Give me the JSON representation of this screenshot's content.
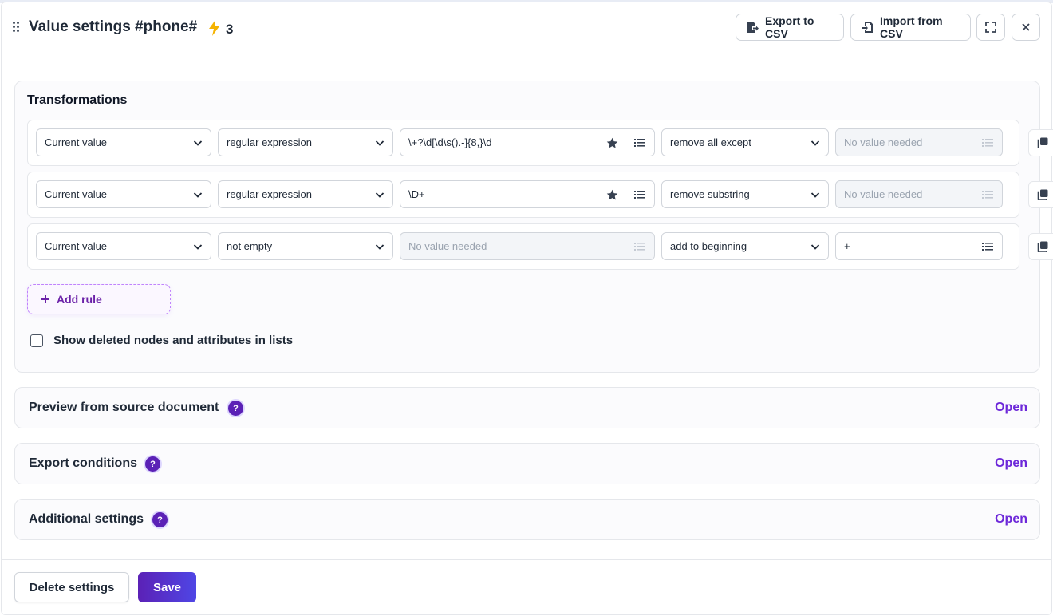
{
  "header": {
    "title": "Value settings #phone#",
    "count": "3",
    "export_label": "Export to CSV",
    "import_label": "Import from CSV"
  },
  "transformations": {
    "title": "Transformations",
    "rules": [
      {
        "source": "Current value",
        "condition": "regular expression",
        "pattern": "\\+?\\d[\\d\\s().-]{8,}\\d",
        "pattern_placeholder": "",
        "action": "remove all except",
        "action_value": "",
        "action_value_placeholder": "No value needed"
      },
      {
        "source": "Current value",
        "condition": "regular expression",
        "pattern": "\\D+",
        "pattern_placeholder": "",
        "action": "remove substring",
        "action_value": "",
        "action_value_placeholder": "No value needed"
      },
      {
        "source": "Current value",
        "condition": "not empty",
        "pattern": "",
        "pattern_placeholder": "No value needed",
        "action": "add to beginning",
        "action_value": "+",
        "action_value_placeholder": ""
      }
    ],
    "add_rule_label": "Add rule",
    "show_deleted_label": "Show deleted nodes and attributes in lists"
  },
  "sections": [
    {
      "title": "Preview from source document",
      "open_label": "Open"
    },
    {
      "title": "Export conditions",
      "open_label": "Open"
    },
    {
      "title": "Additional settings",
      "open_label": "Open"
    }
  ],
  "help_glyph": "?",
  "footer": {
    "delete_label": "Delete settings",
    "save_label": "Save"
  },
  "colors": {
    "accent": "#6d28d9",
    "save_gradient_start": "#5b21b6",
    "save_gradient_end": "#4f46e5",
    "bolt": "#f5b301"
  },
  "icons": {
    "drag": "drag-handle-icon",
    "bolt": "lightning-icon",
    "export": "export-file-icon",
    "import": "import-file-icon",
    "fullscreen": "fullscreen-icon",
    "close": "close-icon",
    "chevron": "chevron-down-icon",
    "star": "star-icon",
    "list": "list-icon",
    "copy": "copy-icon",
    "plus": "plus-icon"
  }
}
